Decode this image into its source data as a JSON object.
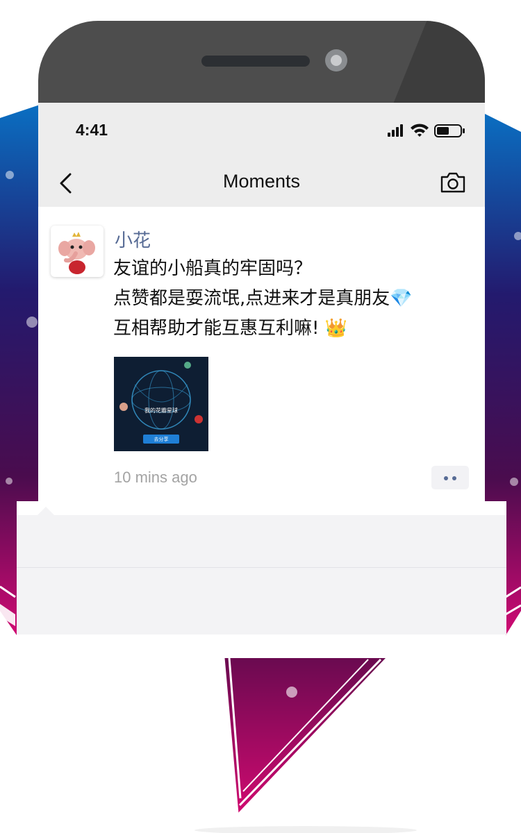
{
  "status_bar": {
    "time": "4:41",
    "icons": [
      "signal-icon",
      "wifi-icon",
      "battery-icon"
    ]
  },
  "nav": {
    "title": "Moments",
    "left_icon": "chevron-left-icon",
    "right_icon": "camera-icon"
  },
  "post": {
    "author": "小花",
    "lines": [
      "友谊的小船真的牢固吗？",
      "点赞都是耍流氓,点进来才是真朋友💎",
      "互相帮助才能互惠互利嘛! 👑"
    ],
    "image": {
      "title": "我的花瓣星球",
      "button": "去分享"
    },
    "timestamp": "10 mins ago"
  },
  "colors": {
    "link": "#576b95",
    "nav_bg": "#ededed",
    "gradient_top": "#0a6fc2",
    "gradient_bottom": "#d10a73"
  }
}
